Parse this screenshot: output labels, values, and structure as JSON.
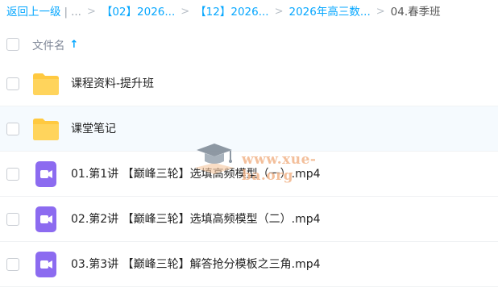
{
  "breadcrumb": {
    "back_label": "返回上一级",
    "divider": "|",
    "ellipsis": "...",
    "separator": ">",
    "items": [
      "【02】2026...",
      "【12】2026...",
      "2026年高三数..."
    ],
    "current": "04.春季班"
  },
  "table": {
    "column_name": "文件名",
    "sort_icon": "arrow-up-icon"
  },
  "files": [
    {
      "type": "folder",
      "name": "课程资料-提升班"
    },
    {
      "type": "folder",
      "name": "课堂笔记"
    },
    {
      "type": "video",
      "name": "01.第1讲 【巅峰三轮】选填高频模型（一）.mp4"
    },
    {
      "type": "video",
      "name": "02.第2讲 【巅峰三轮】选填高频模型（二）.mp4"
    },
    {
      "type": "video",
      "name": "03.第3讲 【巅峰三轮】解答抢分模板之三角.mp4"
    }
  ],
  "watermark": {
    "text": "www.xue-ba.org",
    "icon": "graduation-cap-icon"
  },
  "colors": {
    "accent": "#06a7ff",
    "folder": "#ffc940",
    "video": "#8c6bf0"
  }
}
